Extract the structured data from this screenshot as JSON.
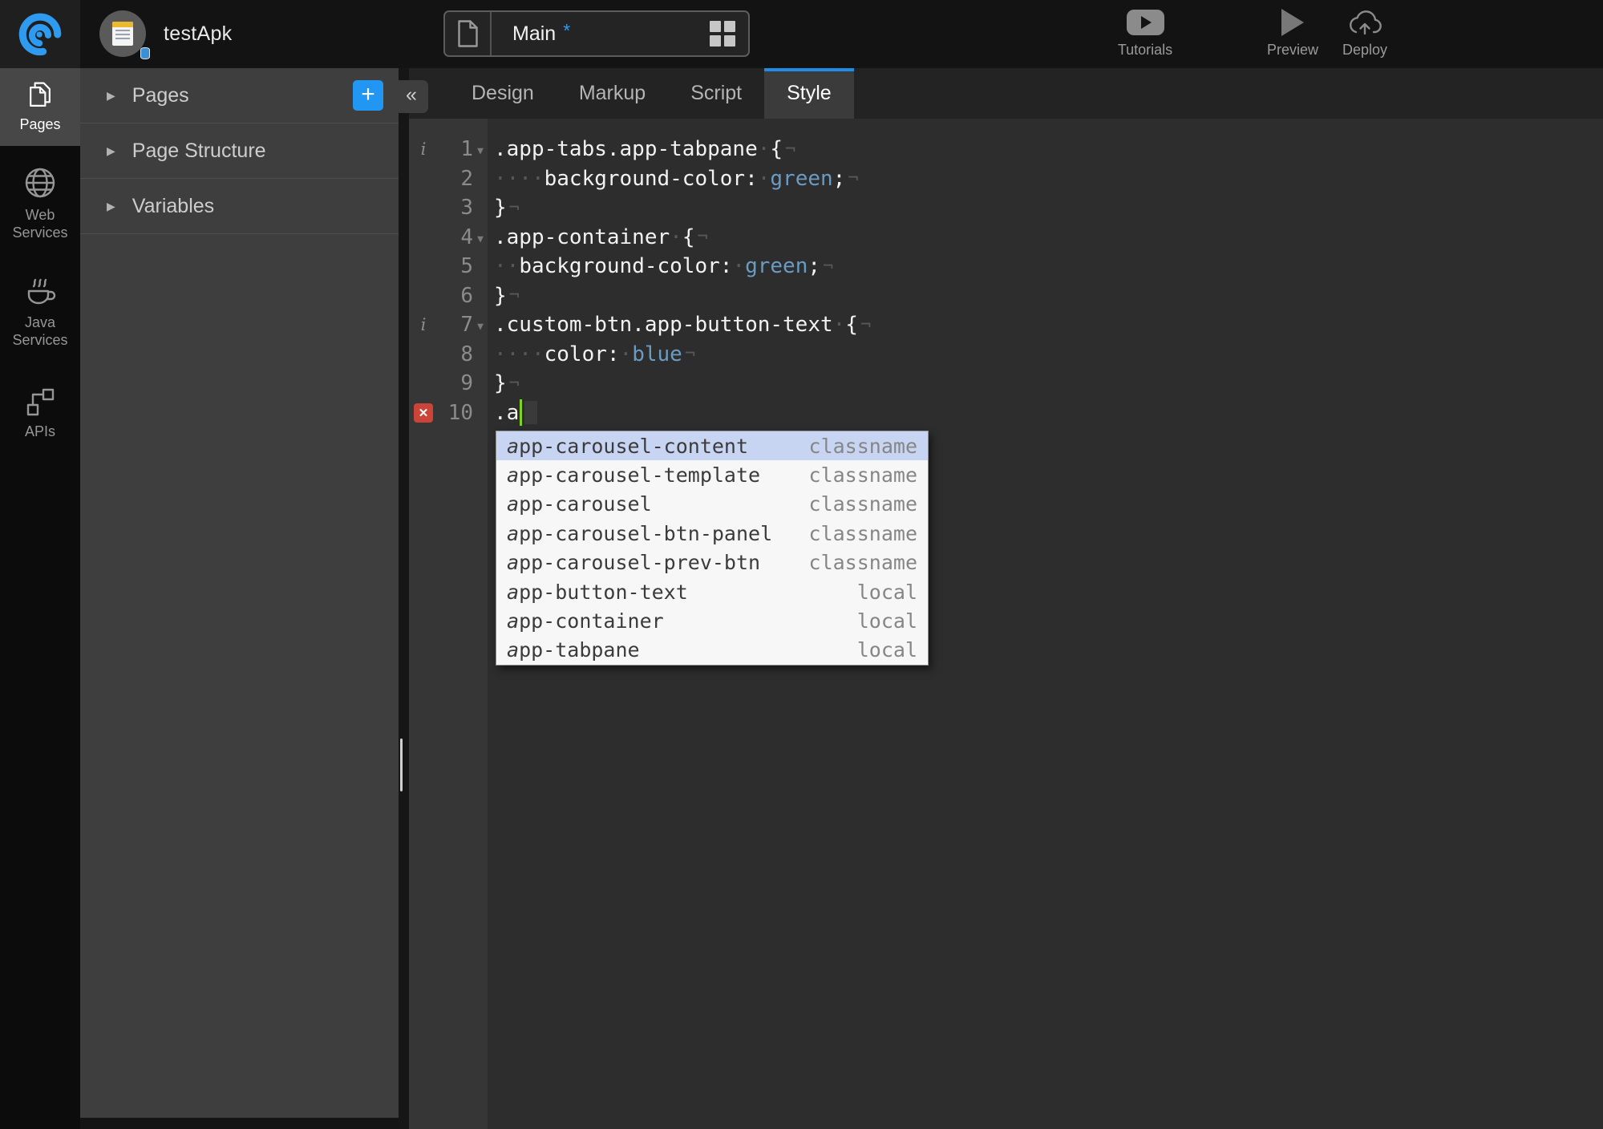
{
  "topbar": {
    "app_name": "testApk",
    "doc_tab": {
      "title": "Main",
      "dirty_marker": "*"
    },
    "actions": {
      "tutorials": "Tutorials",
      "preview": "Preview",
      "deploy": "Deploy"
    }
  },
  "rail": {
    "items": [
      {
        "label": "Pages",
        "active": true
      },
      {
        "label": "Web Services",
        "active": false
      },
      {
        "label": "Java Services",
        "active": false
      },
      {
        "label": "APIs",
        "active": false
      }
    ]
  },
  "panel": {
    "expand_arrow": "▶",
    "collapse_glyph": "«",
    "add_label": "+",
    "sections": [
      {
        "label": "Pages"
      },
      {
        "label": "Page Structure"
      },
      {
        "label": "Variables"
      }
    ]
  },
  "editor_tabs": {
    "items": [
      "Design",
      "Markup",
      "Script",
      "Style"
    ],
    "active": "Style"
  },
  "editor": {
    "glyphs": {
      "info": "i",
      "fold": "▼",
      "error": "✕"
    },
    "lines": [
      {
        "num": "1",
        "tokens": [
          {
            "c": "t",
            "t": ".app-tabs.app-tabpane"
          },
          {
            "c": "ws",
            "t": "·"
          },
          {
            "c": "t",
            "t": "{"
          },
          {
            "c": "eol",
            "t": "¬"
          }
        ]
      },
      {
        "num": "2",
        "tokens": [
          {
            "c": "ws",
            "t": "····"
          },
          {
            "c": "t",
            "t": "background-color:"
          },
          {
            "c": "ws",
            "t": "·"
          },
          {
            "c": "v",
            "t": "green"
          },
          {
            "c": "t",
            "t": ";"
          },
          {
            "c": "eol",
            "t": "¬"
          }
        ]
      },
      {
        "num": "3",
        "tokens": [
          {
            "c": "t",
            "t": "}"
          },
          {
            "c": "eol",
            "t": "¬"
          }
        ]
      },
      {
        "num": "4",
        "tokens": [
          {
            "c": "t",
            "t": ".app-container"
          },
          {
            "c": "ws",
            "t": "·"
          },
          {
            "c": "t",
            "t": "{"
          },
          {
            "c": "eol",
            "t": "¬"
          }
        ]
      },
      {
        "num": "5",
        "tokens": [
          {
            "c": "ws",
            "t": "··"
          },
          {
            "c": "t",
            "t": "background-color:"
          },
          {
            "c": "ws",
            "t": "·"
          },
          {
            "c": "v",
            "t": "green"
          },
          {
            "c": "t",
            "t": ";"
          },
          {
            "c": "eol",
            "t": "¬"
          }
        ]
      },
      {
        "num": "6",
        "tokens": [
          {
            "c": "t",
            "t": "}"
          },
          {
            "c": "eol",
            "t": "¬"
          }
        ]
      },
      {
        "num": "7",
        "tokens": [
          {
            "c": "t",
            "t": ".custom-btn.app-button-text"
          },
          {
            "c": "ws",
            "t": "·"
          },
          {
            "c": "t",
            "t": "{"
          },
          {
            "c": "eol",
            "t": "¬"
          }
        ]
      },
      {
        "num": "8",
        "tokens": [
          {
            "c": "ws",
            "t": "····"
          },
          {
            "c": "t",
            "t": "color:"
          },
          {
            "c": "ws",
            "t": "·"
          },
          {
            "c": "v",
            "t": "blue"
          },
          {
            "c": "eol",
            "t": "¬"
          }
        ]
      },
      {
        "num": "9",
        "tokens": [
          {
            "c": "t",
            "t": "}"
          },
          {
            "c": "eol",
            "t": "¬"
          }
        ]
      },
      {
        "num": "10",
        "tokens": [
          {
            "c": "t",
            "t": ".a"
          },
          {
            "c": "cursor",
            "t": ""
          },
          {
            "c": "ghost",
            "t": ""
          }
        ]
      }
    ]
  },
  "completion": {
    "items": [
      {
        "match": "a",
        "rest": "pp-carousel-content",
        "kind": "classname"
      },
      {
        "match": "a",
        "rest": "pp-carousel-template",
        "kind": "classname"
      },
      {
        "match": "a",
        "rest": "pp-carousel",
        "kind": "classname"
      },
      {
        "match": "a",
        "rest": "pp-carousel-btn-panel",
        "kind": "classname"
      },
      {
        "match": "a",
        "rest": "pp-carousel-prev-btn",
        "kind": "classname"
      },
      {
        "match": "a",
        "rest": "pp-button-text",
        "kind": "local"
      },
      {
        "match": "a",
        "rest": "pp-container",
        "kind": "local"
      },
      {
        "match": "a",
        "rest": "pp-tabpane",
        "kind": "local"
      }
    ]
  },
  "colors": {
    "accent_blue": "#2196f3",
    "tab_accent": "#1d8ee8",
    "css_value_blue": "#6a9bc3",
    "cursor_green": "#7fd41c",
    "error_red": "#cb4437",
    "completion_selected": "#c7d5f2"
  }
}
